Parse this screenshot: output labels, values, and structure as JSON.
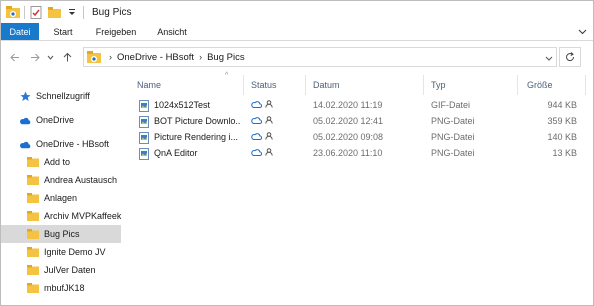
{
  "window": {
    "title": "Bug Pics"
  },
  "ribbon": {
    "tabs": [
      {
        "label": "Datei",
        "active": true
      },
      {
        "label": "Start",
        "active": false
      },
      {
        "label": "Freigeben",
        "active": false
      },
      {
        "label": "Ansicht",
        "active": false
      }
    ]
  },
  "address": {
    "crumbs": [
      "OneDrive - HBsoft",
      "Bug Pics"
    ]
  },
  "navpane": {
    "items": [
      {
        "label": "Schnellzugriff",
        "icon": "star-icon"
      },
      {
        "label": "OneDrive",
        "icon": "cloud-icon"
      },
      {
        "label": "OneDrive - HBsoft",
        "icon": "cloud-icon"
      },
      {
        "label": "Add to",
        "icon": "folder-icon"
      },
      {
        "label": "Andrea Austausch",
        "icon": "folder-icon"
      },
      {
        "label": "Anlagen",
        "icon": "folder-icon"
      },
      {
        "label": "Archiv MVPKaffeekl",
        "icon": "folder-icon"
      },
      {
        "label": "Bug Pics",
        "icon": "folder-icon",
        "selected": true
      },
      {
        "label": "Ignite Demo JV",
        "icon": "folder-icon"
      },
      {
        "label": "JulVer Daten",
        "icon": "folder-icon"
      },
      {
        "label": "mbufJK18",
        "icon": "folder-icon"
      }
    ]
  },
  "columns": {
    "name": "Name",
    "status": "Status",
    "date": "Datum",
    "type": "Typ",
    "size": "Größe"
  },
  "files": [
    {
      "name": "1024x512Test",
      "date": "14.02.2020 11:19",
      "type": "GIF-Datei",
      "size": "944 KB"
    },
    {
      "name": "BOT Picture Downlo...",
      "date": "05.02.2020 12:41",
      "type": "PNG-Datei",
      "size": "359 KB"
    },
    {
      "name": "Picture Rendering i...",
      "date": "05.02.2020 09:08",
      "type": "PNG-Datei",
      "size": "140 KB"
    },
    {
      "name": "QnA Editor",
      "date": "23.06.2020 11:10",
      "type": "PNG-Datei",
      "size": "13 KB"
    }
  ],
  "colors": {
    "accent": "#1979ca",
    "folder": "#f5c342",
    "cloud": "#1c6fcf"
  }
}
